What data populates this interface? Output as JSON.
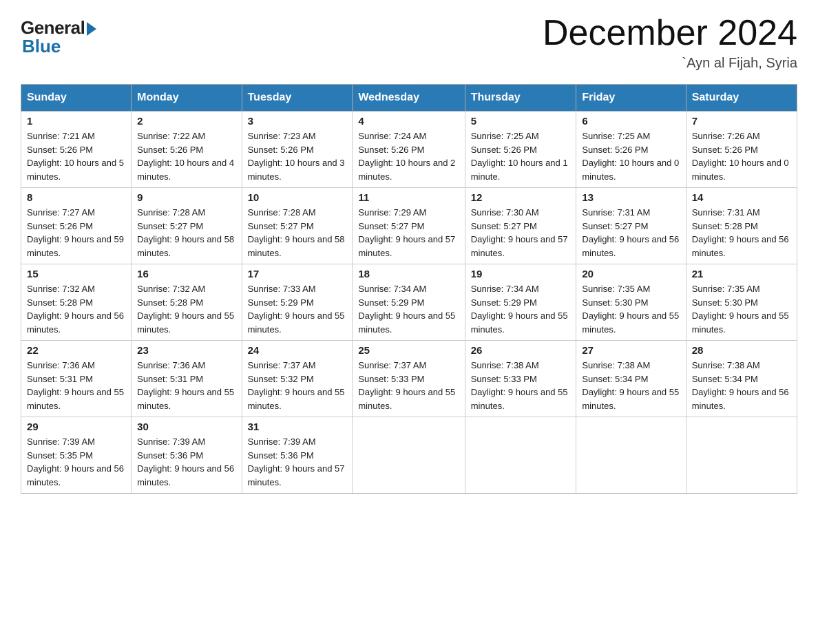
{
  "header": {
    "logo_general": "General",
    "logo_blue": "Blue",
    "title": "December 2024",
    "location": "`Ayn al Fijah, Syria"
  },
  "days_of_week": [
    "Sunday",
    "Monday",
    "Tuesday",
    "Wednesday",
    "Thursday",
    "Friday",
    "Saturday"
  ],
  "weeks": [
    [
      {
        "day": "1",
        "sunrise": "7:21 AM",
        "sunset": "5:26 PM",
        "daylight": "10 hours and 5 minutes."
      },
      {
        "day": "2",
        "sunrise": "7:22 AM",
        "sunset": "5:26 PM",
        "daylight": "10 hours and 4 minutes."
      },
      {
        "day": "3",
        "sunrise": "7:23 AM",
        "sunset": "5:26 PM",
        "daylight": "10 hours and 3 minutes."
      },
      {
        "day": "4",
        "sunrise": "7:24 AM",
        "sunset": "5:26 PM",
        "daylight": "10 hours and 2 minutes."
      },
      {
        "day": "5",
        "sunrise": "7:25 AM",
        "sunset": "5:26 PM",
        "daylight": "10 hours and 1 minute."
      },
      {
        "day": "6",
        "sunrise": "7:25 AM",
        "sunset": "5:26 PM",
        "daylight": "10 hours and 0 minutes."
      },
      {
        "day": "7",
        "sunrise": "7:26 AM",
        "sunset": "5:26 PM",
        "daylight": "10 hours and 0 minutes."
      }
    ],
    [
      {
        "day": "8",
        "sunrise": "7:27 AM",
        "sunset": "5:26 PM",
        "daylight": "9 hours and 59 minutes."
      },
      {
        "day": "9",
        "sunrise": "7:28 AM",
        "sunset": "5:27 PM",
        "daylight": "9 hours and 58 minutes."
      },
      {
        "day": "10",
        "sunrise": "7:28 AM",
        "sunset": "5:27 PM",
        "daylight": "9 hours and 58 minutes."
      },
      {
        "day": "11",
        "sunrise": "7:29 AM",
        "sunset": "5:27 PM",
        "daylight": "9 hours and 57 minutes."
      },
      {
        "day": "12",
        "sunrise": "7:30 AM",
        "sunset": "5:27 PM",
        "daylight": "9 hours and 57 minutes."
      },
      {
        "day": "13",
        "sunrise": "7:31 AM",
        "sunset": "5:27 PM",
        "daylight": "9 hours and 56 minutes."
      },
      {
        "day": "14",
        "sunrise": "7:31 AM",
        "sunset": "5:28 PM",
        "daylight": "9 hours and 56 minutes."
      }
    ],
    [
      {
        "day": "15",
        "sunrise": "7:32 AM",
        "sunset": "5:28 PM",
        "daylight": "9 hours and 56 minutes."
      },
      {
        "day": "16",
        "sunrise": "7:32 AM",
        "sunset": "5:28 PM",
        "daylight": "9 hours and 55 minutes."
      },
      {
        "day": "17",
        "sunrise": "7:33 AM",
        "sunset": "5:29 PM",
        "daylight": "9 hours and 55 minutes."
      },
      {
        "day": "18",
        "sunrise": "7:34 AM",
        "sunset": "5:29 PM",
        "daylight": "9 hours and 55 minutes."
      },
      {
        "day": "19",
        "sunrise": "7:34 AM",
        "sunset": "5:29 PM",
        "daylight": "9 hours and 55 minutes."
      },
      {
        "day": "20",
        "sunrise": "7:35 AM",
        "sunset": "5:30 PM",
        "daylight": "9 hours and 55 minutes."
      },
      {
        "day": "21",
        "sunrise": "7:35 AM",
        "sunset": "5:30 PM",
        "daylight": "9 hours and 55 minutes."
      }
    ],
    [
      {
        "day": "22",
        "sunrise": "7:36 AM",
        "sunset": "5:31 PM",
        "daylight": "9 hours and 55 minutes."
      },
      {
        "day": "23",
        "sunrise": "7:36 AM",
        "sunset": "5:31 PM",
        "daylight": "9 hours and 55 minutes."
      },
      {
        "day": "24",
        "sunrise": "7:37 AM",
        "sunset": "5:32 PM",
        "daylight": "9 hours and 55 minutes."
      },
      {
        "day": "25",
        "sunrise": "7:37 AM",
        "sunset": "5:33 PM",
        "daylight": "9 hours and 55 minutes."
      },
      {
        "day": "26",
        "sunrise": "7:38 AM",
        "sunset": "5:33 PM",
        "daylight": "9 hours and 55 minutes."
      },
      {
        "day": "27",
        "sunrise": "7:38 AM",
        "sunset": "5:34 PM",
        "daylight": "9 hours and 55 minutes."
      },
      {
        "day": "28",
        "sunrise": "7:38 AM",
        "sunset": "5:34 PM",
        "daylight": "9 hours and 56 minutes."
      }
    ],
    [
      {
        "day": "29",
        "sunrise": "7:39 AM",
        "sunset": "5:35 PM",
        "daylight": "9 hours and 56 minutes."
      },
      {
        "day": "30",
        "sunrise": "7:39 AM",
        "sunset": "5:36 PM",
        "daylight": "9 hours and 56 minutes."
      },
      {
        "day": "31",
        "sunrise": "7:39 AM",
        "sunset": "5:36 PM",
        "daylight": "9 hours and 57 minutes."
      },
      null,
      null,
      null,
      null
    ]
  ],
  "labels": {
    "sunrise": "Sunrise:",
    "sunset": "Sunset:",
    "daylight": "Daylight:"
  }
}
